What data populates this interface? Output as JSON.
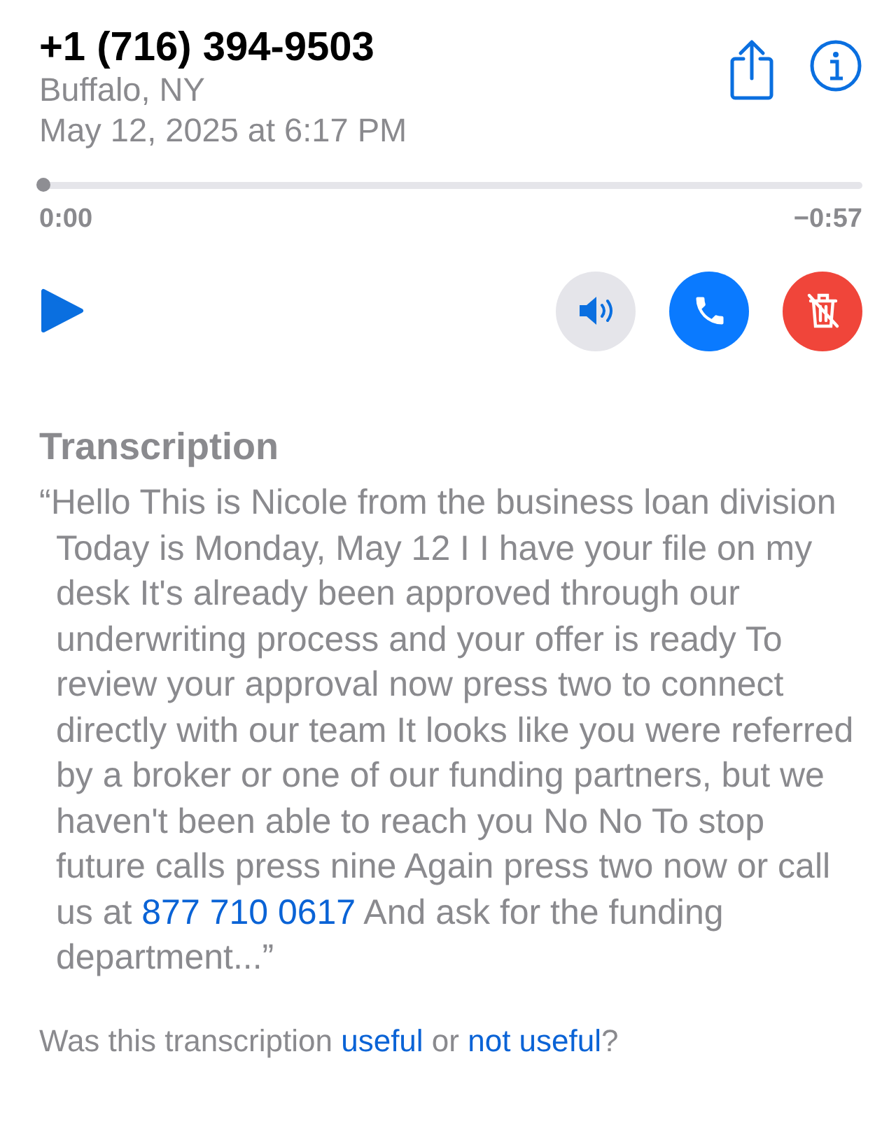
{
  "header": {
    "number": "+1 (716) 394-9503",
    "location": "Buffalo, NY",
    "date": "May 12, 2025 at 6:17 PM"
  },
  "playback": {
    "level": 0,
    "elapsed": "0:00",
    "remaining": "−0:57"
  },
  "actions": [
    {
      "kind": "speaker"
    },
    {
      "kind": "call"
    },
    {
      "kind": "delete"
    }
  ],
  "transcription": {
    "heading": "Transcription",
    "parts": [
      {
        "kind": "text",
        "text": "“Hello This is Nicole from the business loan division Today is Monday, May 12 I I have your file on my desk It's already been approved through our underwriting process and your offer is ready To review your approval now press two to connect directly with our team It looks like you were referred by a broker or one of our funding partners, but we haven't been able to reach you No No To stop future calls press nine Again press two now or call us at "
      },
      {
        "kind": "link",
        "text": "877 710 0617"
      },
      {
        "kind": "text",
        "text": " And ask for the funding department...”"
      }
    ]
  },
  "feedback": {
    "parts": [
      {
        "kind": "text",
        "text": "Was this transcription "
      },
      {
        "kind": "link",
        "text": "useful"
      },
      {
        "kind": "text",
        "text": " or "
      },
      {
        "kind": "link",
        "text": "not useful"
      },
      {
        "kind": "text",
        "text": "?"
      }
    ]
  }
}
